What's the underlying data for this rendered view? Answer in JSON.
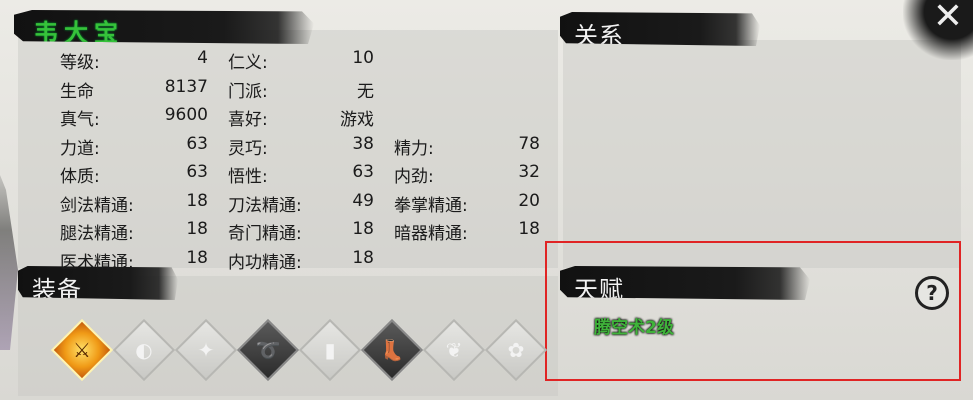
{
  "character": {
    "name": "韦大宝"
  },
  "sections": {
    "relations": "关系",
    "equipment": "装备",
    "talent": "天赋"
  },
  "stats": [
    [
      {
        "label": "等级:",
        "value": "4"
      },
      {
        "label": "仁义:",
        "value": "10"
      },
      null
    ],
    [
      {
        "label": "生命",
        "value": "8137"
      },
      {
        "label": "门派:",
        "value": "无"
      },
      null
    ],
    [
      {
        "label": "真气:",
        "value": "9600"
      },
      {
        "label": "喜好:",
        "value": "游戏"
      },
      null
    ],
    [
      {
        "label": "力道:",
        "value": "63"
      },
      {
        "label": "灵巧:",
        "value": "38"
      },
      {
        "label": "精力:",
        "value": "78"
      }
    ],
    [
      {
        "label": "体质:",
        "value": "63"
      },
      {
        "label": "悟性:",
        "value": "63"
      },
      {
        "label": "内劲:",
        "value": "32"
      }
    ],
    [
      {
        "label": "剑法精通:",
        "value": "18"
      },
      {
        "label": "刀法精通:",
        "value": "49"
      },
      {
        "label": "拳掌精通:",
        "value": "20"
      }
    ],
    [
      {
        "label": "腿法精通:",
        "value": "18"
      },
      {
        "label": "奇门精通:",
        "value": "18"
      },
      {
        "label": "暗器精通:",
        "value": "18"
      }
    ],
    [
      {
        "label": "医术精通:",
        "value": "18"
      },
      {
        "label": "内功精通:",
        "value": "18"
      },
      null
    ]
  ],
  "talents": [
    "腾空术2级"
  ],
  "help": {
    "glyph": "?"
  },
  "close": {
    "glyph": "✕"
  },
  "equipment_slots": [
    {
      "icon": "golden-weapon-icon",
      "glyph": "⚔",
      "style": "gold"
    },
    {
      "icon": "helmet-icon",
      "glyph": "◐",
      "style": "light"
    },
    {
      "icon": "armor-icon",
      "glyph": "✦",
      "style": "light"
    },
    {
      "icon": "whip-icon",
      "glyph": "➰",
      "style": "dark"
    },
    {
      "icon": "book-icon",
      "glyph": "▮",
      "style": "light"
    },
    {
      "icon": "boots-icon",
      "glyph": "👢",
      "style": "dark"
    },
    {
      "icon": "wing-icon",
      "glyph": "❦",
      "style": "light"
    },
    {
      "icon": "ornament-icon",
      "glyph": "✿",
      "style": "light"
    }
  ]
}
